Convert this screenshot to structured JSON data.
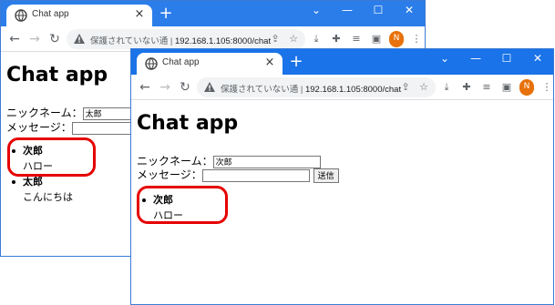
{
  "tab": {
    "title": "Chat app",
    "close": "×",
    "new_tab": "+"
  },
  "window_controls": {
    "minimize": "—",
    "maximize": "☐",
    "close": "✕",
    "chevron": "⌄"
  },
  "address": {
    "security": "保護されていない通",
    "url": "192.168.1.105:8000/chat"
  },
  "profile_initial": "N",
  "page": {
    "heading": "Chat app",
    "nickname_label": "ニックネーム：",
    "message_label": "メッセージ：",
    "send_label": "送信"
  },
  "back_window": {
    "nickname_value": "太郎",
    "messages": [
      {
        "name": "次郎",
        "text": "ハロー"
      },
      {
        "name": "太郎",
        "text": "こんにちは"
      }
    ]
  },
  "front_window": {
    "nickname_value": "次郎",
    "messages": [
      {
        "name": "次郎",
        "text": "ハロー"
      }
    ]
  },
  "colors": {
    "titlebar": "#1a73e8",
    "highlight": "#e60000",
    "avatar": "#e8710a"
  }
}
